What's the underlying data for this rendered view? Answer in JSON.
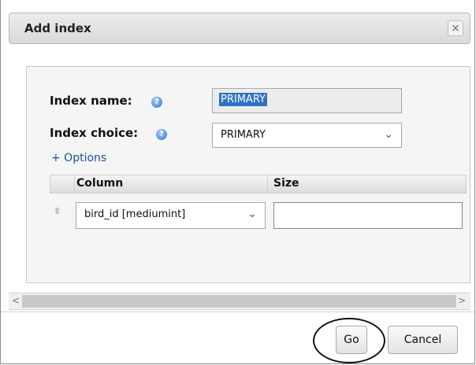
{
  "dialog": {
    "title": "Add index",
    "close_glyph": "×"
  },
  "form": {
    "index_name_label": "Index name:",
    "index_name_value": "PRIMARY",
    "index_choice_label": "Index choice:",
    "index_choice_value": "PRIMARY",
    "options_link": "+ Options",
    "help_glyph": "?"
  },
  "table": {
    "headers": [
      "Column",
      "Size"
    ],
    "rows": [
      {
        "column_value": "bird_id [mediumint]",
        "size_value": ""
      }
    ]
  },
  "icons": {
    "drag_handle": "⇳",
    "chevron": "⌄",
    "scroll_left": "<",
    "scroll_right": ">"
  },
  "buttons": {
    "go": "Go",
    "cancel": "Cancel"
  }
}
